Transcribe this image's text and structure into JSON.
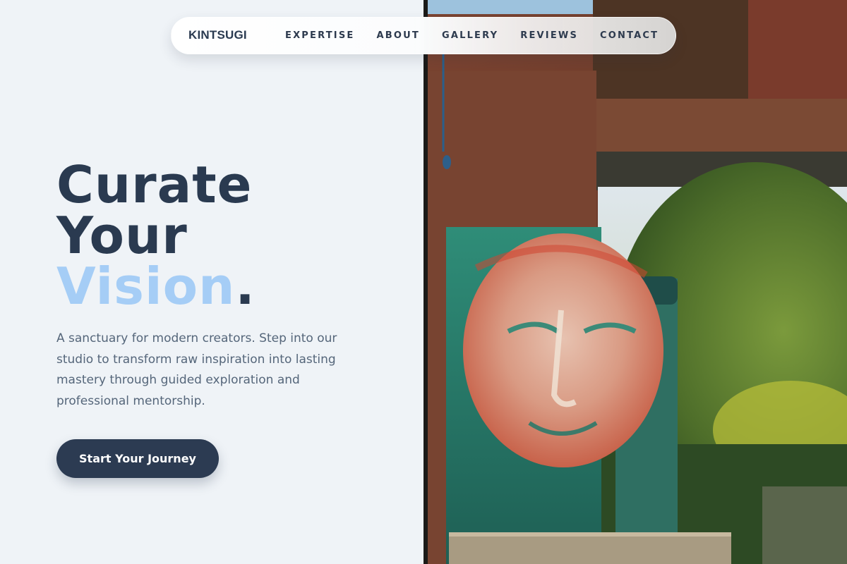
{
  "brand": {
    "name": "KINTSUGI"
  },
  "nav": {
    "links": [
      {
        "label": "EXPERTISE"
      },
      {
        "label": "ABOUT"
      },
      {
        "label": "GALLERY"
      },
      {
        "label": "REVIEWS"
      },
      {
        "label": "CONTACT"
      }
    ]
  },
  "hero": {
    "headline_line1": "Curate",
    "headline_line2": "Your",
    "headline_accent": "Vision",
    "headline_period": ".",
    "description": "A sanctuary for modern creators. Step into our studio to transform raw inspiration into lasting mastery through guided exploration and professional mentorship.",
    "cta_label": "Start Your Journey",
    "image_alt": "Painted face artwork on a rusted metal wall beside a garden"
  },
  "colors": {
    "accent": "#a5cdf6",
    "primary": "#2c3b52",
    "background": "#eff3f7"
  }
}
